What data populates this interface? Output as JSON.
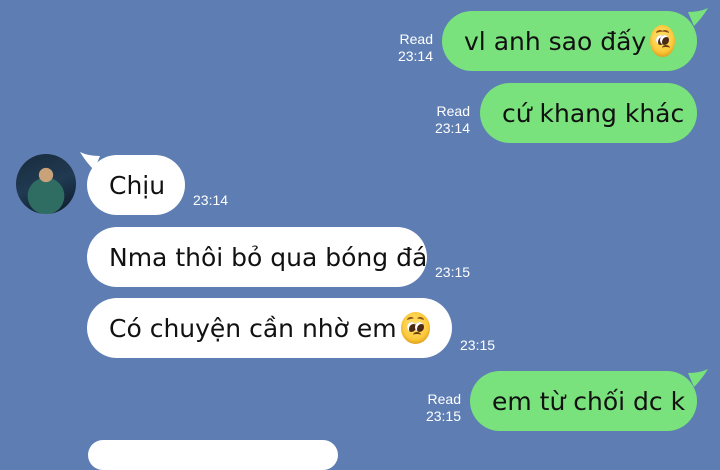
{
  "colors": {
    "background": "#5e7eb3",
    "outgoing_bubble": "#79e27c",
    "incoming_bubble": "#ffffff"
  },
  "messages": [
    {
      "direction": "out",
      "text": "vl anh sao đấy",
      "emoji": "pleading-face-emoji",
      "status": "Read",
      "time": "23:14"
    },
    {
      "direction": "out",
      "text": "cứ khang khác",
      "status": "Read",
      "time": "23:14"
    },
    {
      "direction": "in",
      "text": "Chịu",
      "time": "23:14",
      "avatar": true
    },
    {
      "direction": "in",
      "text": "Nma thôi bỏ qua bóng đá",
      "time": "23:15"
    },
    {
      "direction": "in",
      "text": "Có chuyện cần nhờ em ",
      "emoji": "pleading-face-emoji",
      "time": "23:15"
    },
    {
      "direction": "out",
      "text": "em từ chối dc k",
      "status": "Read",
      "time": "23:15"
    }
  ]
}
